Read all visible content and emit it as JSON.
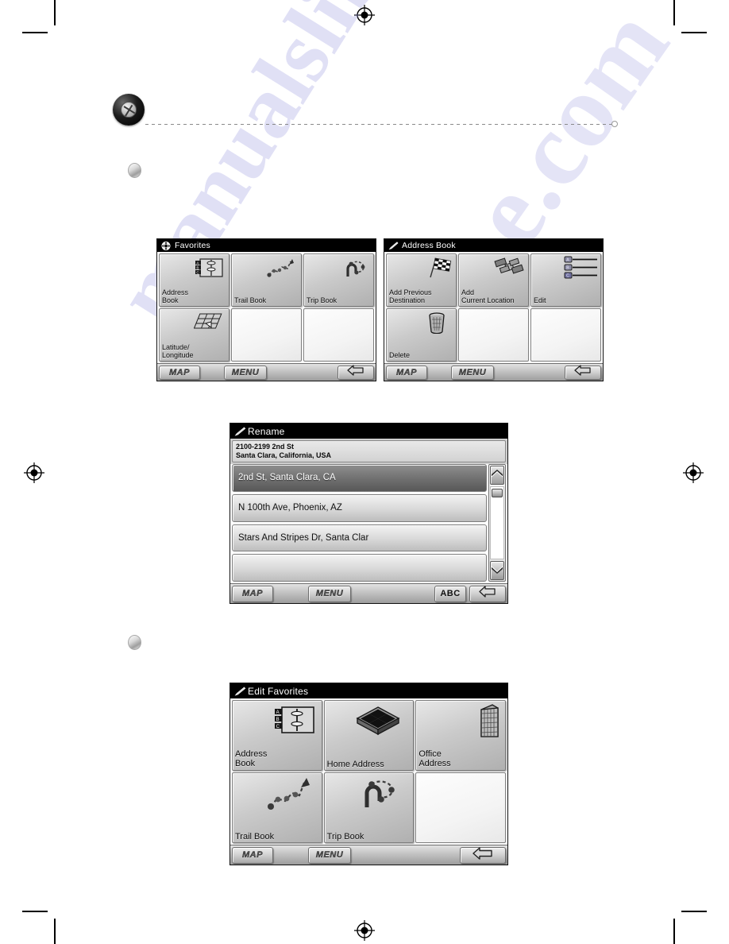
{
  "page": {
    "watermark_text": "manualslib",
    "watermark_text2": "e.com"
  },
  "screens": [
    {
      "id": "favorites",
      "title": "Favorites",
      "title_icon": "compass-badge-icon",
      "cells": [
        {
          "label": "Address\nBook",
          "icon": "address-book-icon"
        },
        {
          "label": "Trail Book",
          "icon": "trail-book-icon"
        },
        {
          "label": "Trip Book",
          "icon": "trip-book-icon"
        },
        {
          "label": "Latitude/\nLongitude",
          "icon": "lat-long-grid-icon"
        },
        {
          "label": "",
          "icon": ""
        },
        {
          "label": "",
          "icon": ""
        }
      ],
      "bottom": {
        "map": "MAP",
        "menu": "MENU",
        "back": "back-arrow-icon"
      }
    },
    {
      "id": "address-book",
      "title": "Address Book",
      "title_icon": "pencil-icon",
      "cells": [
        {
          "label": "Add Previous\nDestination",
          "icon": "checkered-flag-icon"
        },
        {
          "label": "Add\nCurrent Location",
          "icon": "satellite-icon"
        },
        {
          "label": "Edit",
          "icon": "abc-list-icon"
        },
        {
          "label": "Delete",
          "icon": "trash-can-icon"
        },
        {
          "label": "",
          "icon": ""
        },
        {
          "label": "",
          "icon": ""
        }
      ],
      "bottom": {
        "map": "MAP",
        "menu": "MENU",
        "back": "back-arrow-icon"
      }
    },
    {
      "id": "rename",
      "title": "Rename",
      "title_icon": "pencil-icon",
      "address_header": {
        "line1": "2100-2199 2nd St",
        "line2": "Santa Clara, California, USA"
      },
      "list": [
        {
          "text": "2nd St, Santa Clara, CA",
          "selected": true
        },
        {
          "text": "N 100th Ave, Phoenix, AZ",
          "selected": false
        },
        {
          "text": "Stars And Stripes Dr, Santa Clar",
          "selected": false
        },
        {
          "text": "",
          "selected": false
        }
      ],
      "scrollbar": {
        "up": "chevron-up-icon",
        "down": "chevron-down-icon"
      },
      "bottom": {
        "map": "MAP",
        "menu": "MENU",
        "abc": "ABC",
        "back": "back-arrow-icon"
      }
    },
    {
      "id": "edit-favorites",
      "title": "Edit Favorites",
      "title_icon": "pencil-icon",
      "cells": [
        {
          "label": "Address\nBook",
          "icon": "address-book-icon"
        },
        {
          "label": "Home Address",
          "icon": "home-icon"
        },
        {
          "label": "Office\nAddress",
          "icon": "office-building-icon"
        },
        {
          "label": "Trail Book",
          "icon": "trail-book-icon"
        },
        {
          "label": "Trip Book",
          "icon": "trip-book-icon"
        },
        {
          "label": "",
          "icon": ""
        }
      ],
      "bottom": {
        "map": "MAP",
        "menu": "MENU",
        "back": "back-arrow-icon"
      }
    }
  ]
}
